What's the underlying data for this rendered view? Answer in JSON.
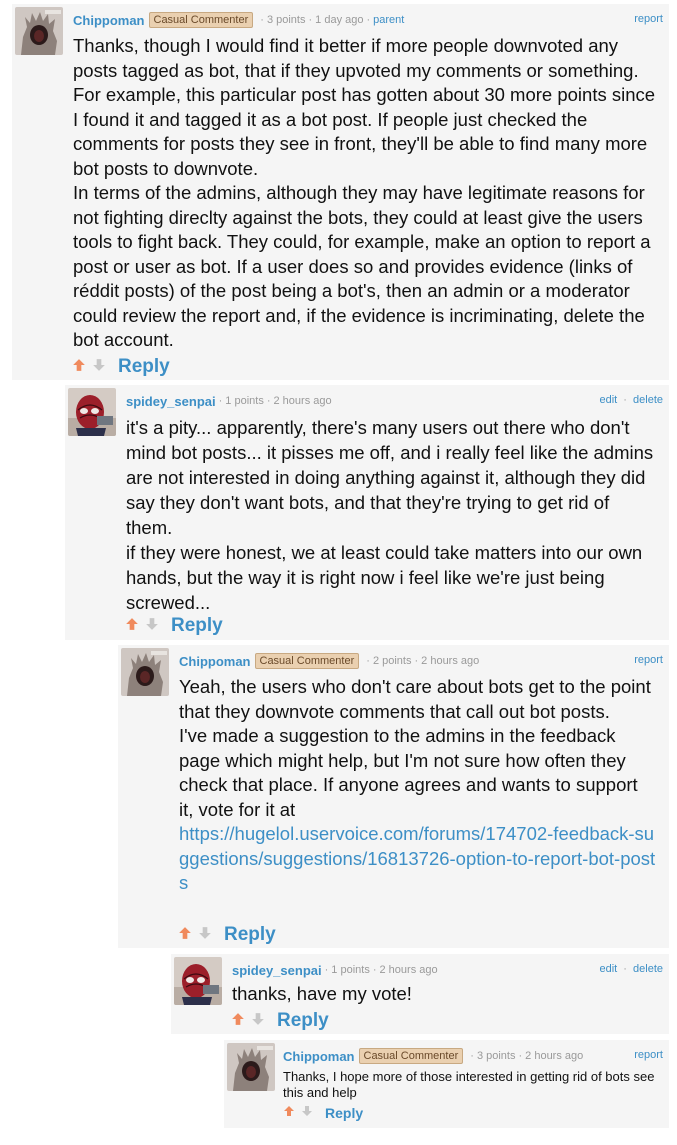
{
  "ui": {
    "points_suffix": "points",
    "reply": "Reply",
    "report": "report",
    "edit": "edit",
    "delete": "delete",
    "parent": "parent",
    "colors": {
      "link": "#3d8fc6",
      "upvote": "#f08a5d",
      "downvote": "#c7c7c7",
      "badge_bg": "#ead0b0"
    }
  },
  "comments": [
    {
      "user": "Chippoman",
      "badge": "Casual Commenter",
      "points": "3",
      "time": "1 day ago",
      "avatar": "chippoman-avatar",
      "paragraphs": [
        "Thanks, though I would find it better if more people downvoted any posts tagged as bot, that if they upvoted my comments or something. For example, this particular post has gotten about 30 more points since I found it and tagged it as a bot post. If people just checked the comments for posts they see in front, they'll be able to find many more bot posts to downvote.",
        "In terms of the admins, although they may have legitimate reasons for not fighting direclty against the bots, they could at least give the users tools to fight back. They could, for example, make an option to report a post or user as bot. If a user does so and provides evidence (links of réddit posts) of the post being a bot's, then an admin or a moderator could review the report and, if the evidence is incriminating, delete the bot account."
      ]
    },
    {
      "user": "spidey_senpai",
      "points": "1",
      "time": "2 hours ago",
      "avatar": "spiderman-avatar",
      "paragraphs": [
        "it's a pity... apparently, there's many users out there who don't mind bot posts... it pisses me off, and i really feel like the admins are not interested in doing anything against it, although they did say they don't want bots, and that they're trying to get rid of them.",
        "if they were honest, we at least could take matters into our own hands, but the way it is right now i feel like we're just being screwed..."
      ]
    },
    {
      "user": "Chippoman",
      "badge": "Casual Commenter",
      "points": "2",
      "time": "2 hours ago",
      "avatar": "chippoman-avatar",
      "paragraphs": [
        "Yeah, the users who don't care about bots get to the point that they downvote comments that call out bot posts.",
        "I've made a suggestion to the admins in the feedback page which might help, but I'm not sure how often they check that place. If anyone agrees and wants to support it, vote for it at"
      ],
      "url": "https://hugelol.uservoice.com/forums/174702-feedback-suggestions/suggestions/16813726-option-to-report-bot-posts"
    },
    {
      "user": "spidey_senpai",
      "points": "1",
      "time": "2 hours ago",
      "avatar": "spiderman-avatar",
      "paragraphs": [
        "thanks, have my vote!"
      ]
    },
    {
      "user": "Chippoman",
      "badge": "Casual Commenter",
      "points": "3",
      "time": "2 hours ago",
      "avatar": "chippoman-avatar",
      "paragraphs": [
        "Thanks, I hope more of those interested in getting rid of bots see this and help"
      ]
    }
  ]
}
